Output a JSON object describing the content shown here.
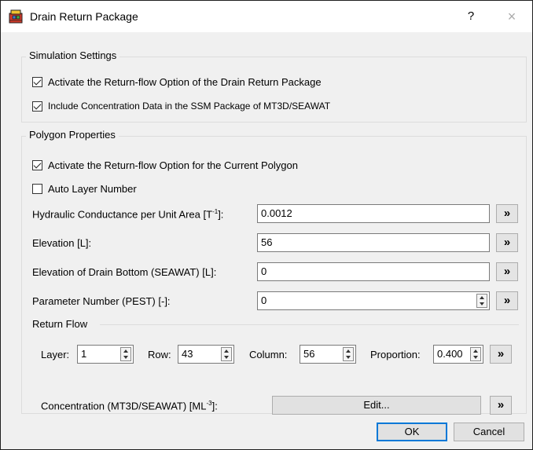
{
  "window": {
    "title": "Drain Return Package",
    "help_label": "?",
    "close_label": "×"
  },
  "simulation": {
    "group_label": "Simulation Settings",
    "activate_return_flow": {
      "label": "Activate the Return-flow Option of the Drain Return Package",
      "checked": true
    },
    "include_concentration": {
      "label": "Include Concentration Data in the SSM Package of MT3D/SEAWAT",
      "checked": true
    }
  },
  "polygon": {
    "group_label": "Polygon Properties",
    "activate_current": {
      "label": "Activate the Return-flow Option for the Current Polygon",
      "checked": true
    },
    "auto_layer": {
      "label": "Auto Layer Number",
      "checked": false
    },
    "hydraulic_conductance": {
      "label_prefix": "Hydraulic Conductance per Unit Area [T",
      "label_sup": "-1",
      "label_suffix": "]:",
      "value": "0.0012"
    },
    "elevation": {
      "label": "Elevation [L]:",
      "value": "56"
    },
    "drain_bottom": {
      "label": "Elevation of Drain Bottom (SEAWAT) [L]:",
      "value": "0"
    },
    "parameter_number": {
      "label": "Parameter Number (PEST) [-]:",
      "value": "0"
    },
    "go_label": "»"
  },
  "return_flow": {
    "section_label": "Return Flow",
    "layer": {
      "label": "Layer:",
      "value": "1"
    },
    "row": {
      "label": "Row:",
      "value": "43"
    },
    "column": {
      "label": "Column:",
      "value": "56"
    },
    "proportion": {
      "label": "Proportion:",
      "value": "0.400"
    },
    "concentration": {
      "label_prefix": "Concentration (MT3D/SEAWAT) [ML",
      "label_sup": "-3",
      "label_suffix": "]:",
      "edit_label": "Edit..."
    }
  },
  "buttons": {
    "ok": "OK",
    "cancel": "Cancel"
  },
  "colors": {
    "default_button_border": "#0078d7",
    "dialog_bg": "#f0f0f0"
  }
}
